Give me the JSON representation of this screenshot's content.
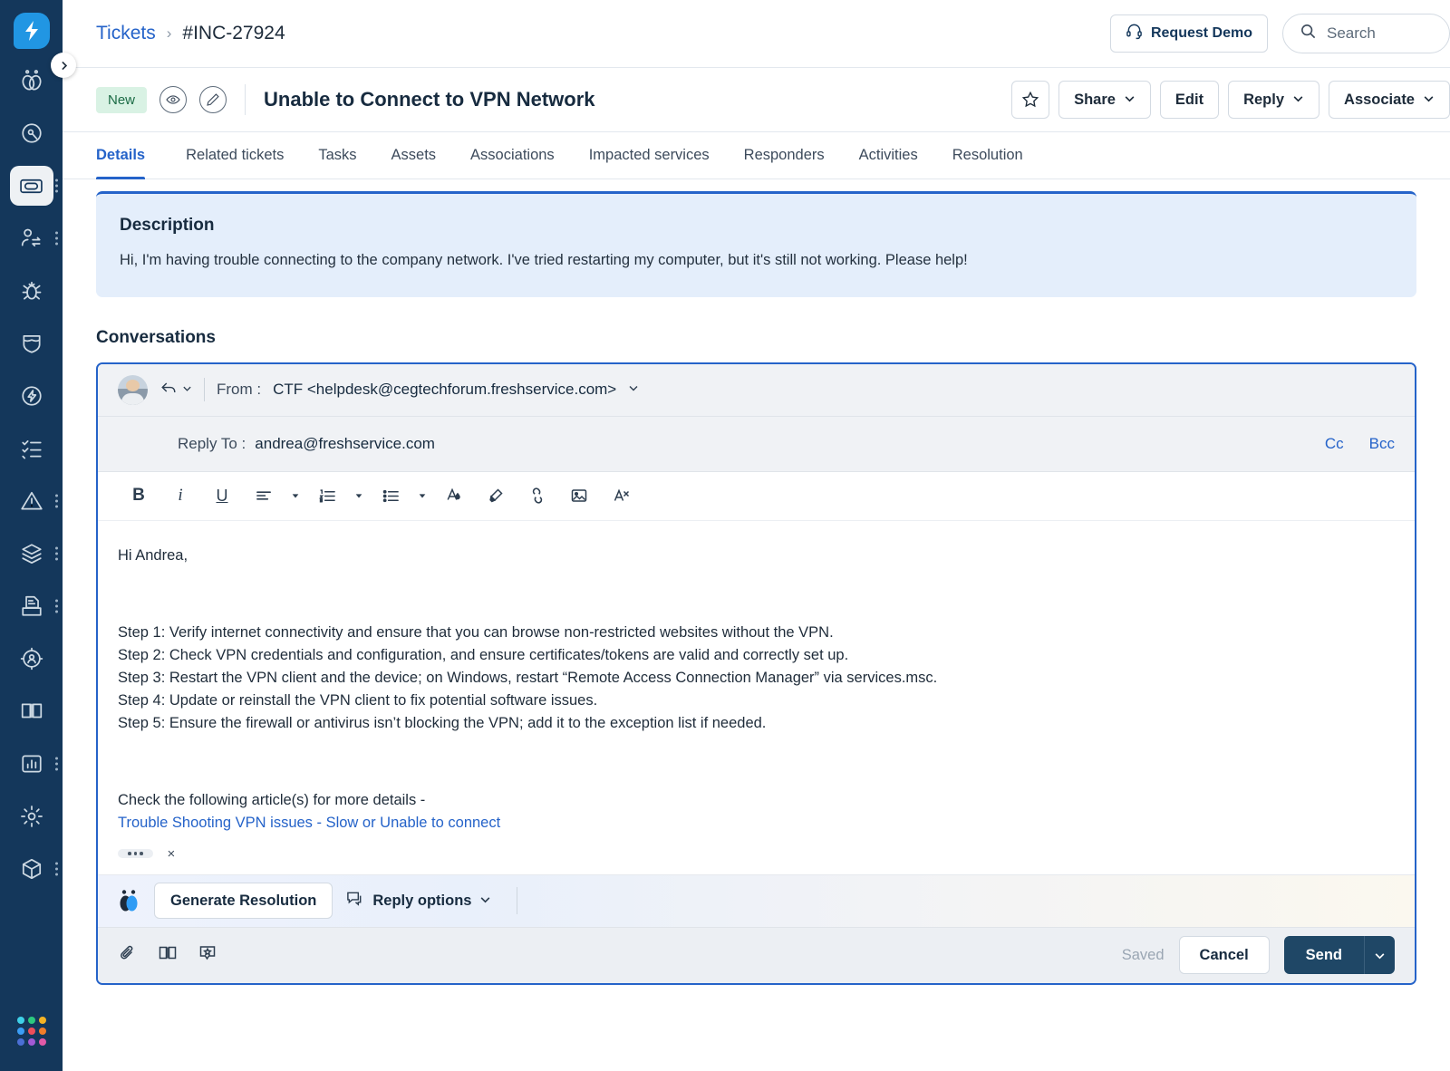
{
  "rail": {
    "logo_icon": "freshservice-bolt-logo",
    "items": [
      {
        "icon": "freddy-ai-icon",
        "name": "freddy-ai",
        "active": false,
        "has_menu": false
      },
      {
        "icon": "compass-icon",
        "name": "discovery",
        "active": false,
        "has_menu": false
      },
      {
        "icon": "ticket-icon",
        "name": "tickets",
        "active": true,
        "has_menu": true
      },
      {
        "icon": "user-switch-icon",
        "name": "requesters",
        "active": false,
        "has_menu": true
      },
      {
        "icon": "bug-icon",
        "name": "problems",
        "active": false,
        "has_menu": false
      },
      {
        "icon": "shield-icon",
        "name": "changes",
        "active": false,
        "has_menu": false
      },
      {
        "icon": "bolt-circle-icon",
        "name": "releases",
        "active": false,
        "has_menu": false
      },
      {
        "icon": "checklist-icon",
        "name": "tasks",
        "active": false,
        "has_menu": false
      },
      {
        "icon": "alert-triangle-icon",
        "name": "alerts",
        "active": false,
        "has_menu": true
      },
      {
        "icon": "layers-icon",
        "name": "assets",
        "active": false,
        "has_menu": true
      },
      {
        "icon": "contracts-icon",
        "name": "contracts",
        "active": false,
        "has_menu": true
      },
      {
        "icon": "onboarding-icon",
        "name": "onboarding",
        "active": false,
        "has_menu": false
      },
      {
        "icon": "book-icon",
        "name": "solutions",
        "active": false,
        "has_menu": false
      },
      {
        "icon": "chart-icon",
        "name": "analytics",
        "active": false,
        "has_menu": true
      },
      {
        "icon": "gear-icon",
        "name": "admin",
        "active": false,
        "has_menu": false
      },
      {
        "icon": "cube-icon",
        "name": "marketplace",
        "active": false,
        "has_menu": true
      }
    ],
    "grid_colors": [
      "#3fd0e8",
      "#2cc97f",
      "#f5b324",
      "#3b9ef5",
      "#ef4e5a",
      "#f07d2a",
      "#4b6fd6",
      "#a25ad6",
      "#e05aa8"
    ],
    "collapse_icon": "chevron-right-icon"
  },
  "topbar": {
    "breadcrumb": {
      "parent": "Tickets",
      "separator": "›",
      "current": "#INC-27924"
    },
    "request_demo_label": "Request Demo",
    "request_demo_icon": "headset-icon",
    "search_placeholder": "Search",
    "search_icon": "search-icon"
  },
  "subject_bar": {
    "status_badge": "New",
    "watch_icon": "eye-icon",
    "edit_icon": "pencil-icon",
    "title": "Unable to Connect to VPN Network",
    "star_icon": "star-icon",
    "actions": [
      {
        "label": "Share",
        "caret": true
      },
      {
        "label": "Edit",
        "caret": false
      },
      {
        "label": "Reply",
        "caret": true
      },
      {
        "label": "Associate",
        "caret": true
      }
    ]
  },
  "tabs": [
    {
      "label": "Details",
      "active": true
    },
    {
      "label": "Related tickets",
      "active": false
    },
    {
      "label": "Tasks",
      "active": false
    },
    {
      "label": "Assets",
      "active": false
    },
    {
      "label": "Associations",
      "active": false
    },
    {
      "label": "Impacted services",
      "active": false
    },
    {
      "label": "Responders",
      "active": false
    },
    {
      "label": "Activities",
      "active": false
    },
    {
      "label": "Resolution",
      "active": false
    }
  ],
  "description": {
    "heading": "Description",
    "body": "Hi, I'm having trouble connecting to the company network. I've tried restarting my computer, but it's still not working. Please help!"
  },
  "conversations": {
    "heading": "Conversations",
    "composer": {
      "reply_icon": "reply-arrow-icon",
      "reply_caret_icon": "chevron-down-icon",
      "from_label": "From :",
      "from_value": "CTF <helpdesk@cegtechforum.freshservice.com>",
      "from_caret_icon": "chevron-down-icon",
      "reply_to_label": "Reply To :",
      "reply_to_value": "andrea@freshservice.com",
      "cc_label": "Cc",
      "bcc_label": "Bcc",
      "toolbar": [
        {
          "icon": "bold-icon",
          "glyph": "B",
          "caret": false
        },
        {
          "icon": "italic-icon",
          "glyph": "i",
          "caret": false
        },
        {
          "icon": "underline-icon",
          "glyph": "U",
          "caret": false
        },
        {
          "icon": "align-left-icon",
          "glyph": "",
          "caret": true
        },
        {
          "icon": "ordered-list-icon",
          "glyph": "",
          "caret": true
        },
        {
          "icon": "bullet-list-icon",
          "glyph": "",
          "caret": true
        },
        {
          "icon": "font-color-icon",
          "glyph": "",
          "caret": false
        },
        {
          "icon": "highlighter-icon",
          "glyph": "",
          "caret": false
        },
        {
          "icon": "link-icon",
          "glyph": "",
          "caret": false
        },
        {
          "icon": "image-icon",
          "glyph": "",
          "caret": false
        },
        {
          "icon": "clear-format-icon",
          "glyph": "",
          "caret": false
        }
      ],
      "body_lines": [
        {
          "type": "text",
          "text": "Hi Andrea,"
        },
        {
          "type": "gap"
        },
        {
          "type": "gap"
        },
        {
          "type": "text",
          "text": "Step 1: Verify internet connectivity and ensure that you can browse non-restricted websites without the VPN."
        },
        {
          "type": "text",
          "text": "Step 2: Check VPN credentials and configuration, and ensure certificates/tokens are valid and correctly set up."
        },
        {
          "type": "text",
          "text": "Step 3: Restart the VPN client and the device; on Windows, restart “Remote Access Connection Manager” via services.msc."
        },
        {
          "type": "text",
          "text": "Step 4: Update or reinstall the VPN client to fix potential software issues."
        },
        {
          "type": "text",
          "text": "Step 5: Ensure the firewall or antivirus isn’t blocking the VPN; add it to the exception list if needed."
        },
        {
          "type": "gap"
        },
        {
          "type": "gap"
        },
        {
          "type": "text",
          "text": "Check the following article(s) for more details -"
        },
        {
          "type": "link",
          "text": "Trouble Shooting VPN issues - Slow or Unable to connect"
        }
      ],
      "chips": {
        "more_icon": "ellipsis-icon",
        "close_icon": "close-icon",
        "close_glyph": "×"
      },
      "ai_bar": {
        "logo_icon": "freddy-ai-icon",
        "generate_label": "Generate Resolution",
        "reply_options_label": "Reply options",
        "reply_options_icon": "chat-bubble-icon",
        "reply_options_caret": "chevron-down-icon"
      },
      "footer": {
        "attach_icon": "paperclip-icon",
        "solutions_icon": "book-icon",
        "canned_icon": "canned-response-icon",
        "saved_label": "Saved",
        "cancel_label": "Cancel",
        "send_label": "Send",
        "send_caret_icon": "chevron-down-icon"
      }
    }
  },
  "colors": {
    "rail_bg": "#14375b",
    "accent_blue": "#2563c9",
    "brand_blue": "#2196e3",
    "desc_bg": "#e4eefb",
    "badge_new_bg": "#d9f2e4",
    "badge_new_fg": "#1b6b45",
    "send_bg": "#1f4766"
  }
}
